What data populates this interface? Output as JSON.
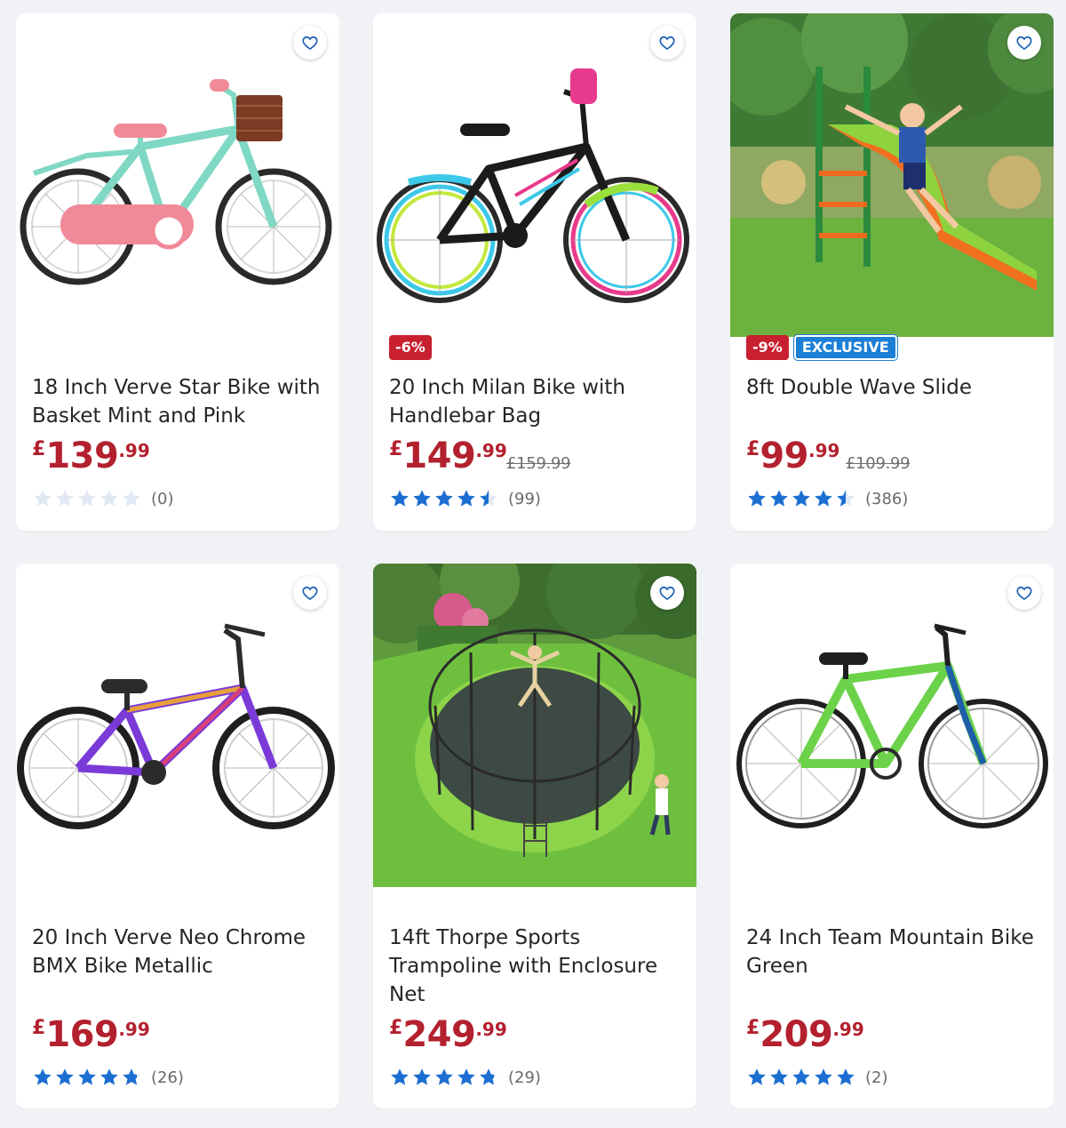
{
  "products": [
    {
      "title": "18 Inch Verve Star Bike with Basket Mint and Pink",
      "price": {
        "currency": "£",
        "whole": "139",
        "decimal": ".99"
      },
      "was_price": "",
      "badges": [],
      "rating": 0,
      "review_count": "(0)",
      "image": "mint-bike-image"
    },
    {
      "title": "20 Inch Milan Bike with Handlebar Bag",
      "price": {
        "currency": "£",
        "whole": "149",
        "decimal": ".99"
      },
      "was_price": "£159.99",
      "badges": [
        "-6%"
      ],
      "rating": 4.5,
      "review_count": "(99)",
      "image": "black-bike-image"
    },
    {
      "title": "8ft Double Wave Slide",
      "price": {
        "currency": "£",
        "whole": "99",
        "decimal": ".99"
      },
      "was_price": "£109.99",
      "badges": [
        "-9%",
        "EXCLUSIVE"
      ],
      "rating": 4.5,
      "review_count": "(386)",
      "image": "slide-photo"
    },
    {
      "title": "20 Inch Verve Neo Chrome BMX Bike Metallic",
      "price": {
        "currency": "£",
        "whole": "169",
        "decimal": ".99"
      },
      "was_price": "",
      "badges": [],
      "rating": 4.8,
      "review_count": "(26)",
      "image": "bmx-bike-image"
    },
    {
      "title": "14ft Thorpe Sports Trampoline with Enclosure Net",
      "price": {
        "currency": "£",
        "whole": "249",
        "decimal": ".99"
      },
      "was_price": "",
      "badges": [],
      "rating": 4.8,
      "review_count": "(29)",
      "image": "trampoline-photo"
    },
    {
      "title": "24 Inch Team Mountain Bike Green",
      "price": {
        "currency": "£",
        "whole": "209",
        "decimal": ".99"
      },
      "was_price": "",
      "badges": [],
      "rating": 5,
      "review_count": "(2)",
      "image": "mountain-bike-image"
    }
  ],
  "colors": {
    "price": "#b3202e",
    "star_filled": "#1c6fd1",
    "star_empty": "#dfe8f3",
    "favorite_icon": "#1a5fb4",
    "discount_badge": "#c8202f",
    "exclusive_badge": "#1c7fd6"
  },
  "icons": {
    "favorite": "heart-outline-icon",
    "rating": "star-icon"
  }
}
